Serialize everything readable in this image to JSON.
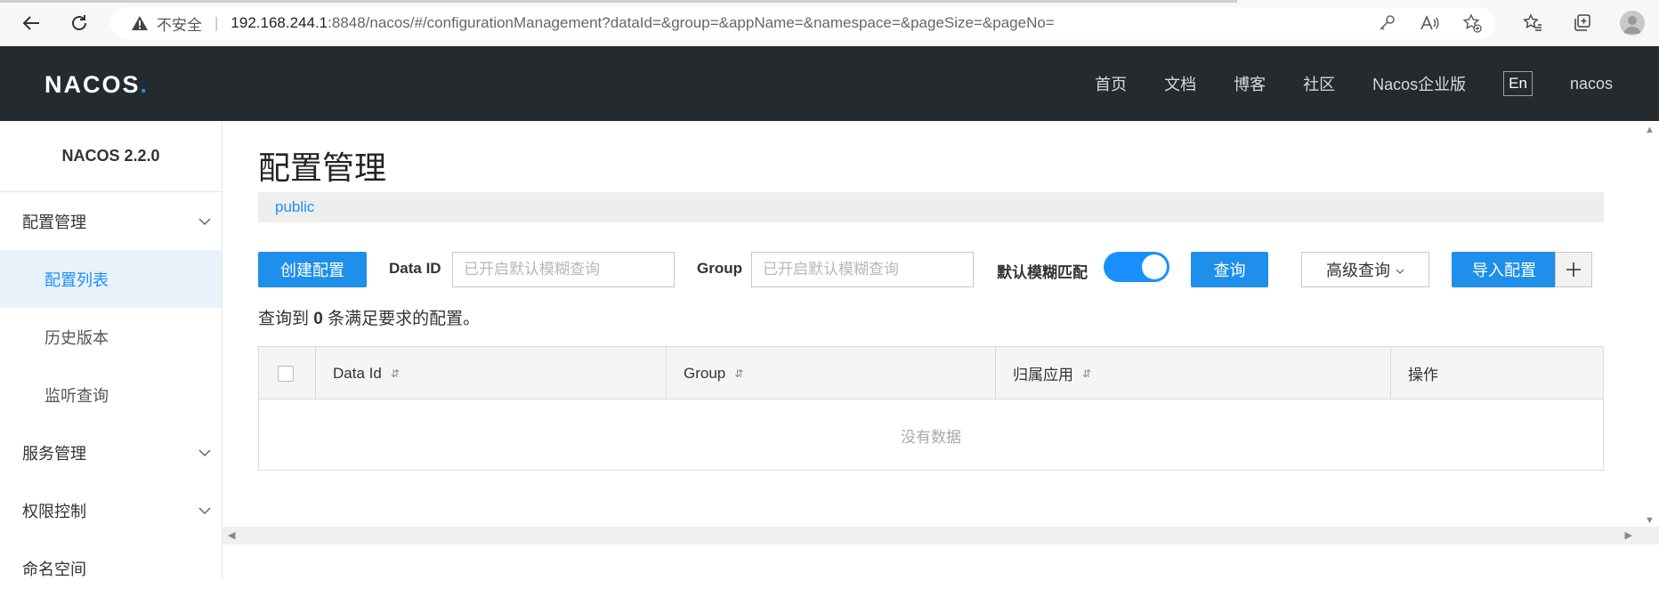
{
  "browser": {
    "insecure_label": "不安全",
    "url_host": "192.168.244.1",
    "url_path": ":8848/nacos/#/configurationManagement?dataId=&group=&appName=&namespace=&pageSize=&pageNo="
  },
  "header": {
    "logo": "NACOS",
    "logo_dot": ".",
    "menu": [
      "首页",
      "文档",
      "博客",
      "社区",
      "Nacos企业版"
    ],
    "lang": "En",
    "user": "nacos"
  },
  "sidebar": {
    "version": "NACOS 2.2.0",
    "groups": [
      {
        "label": "配置管理",
        "items": [
          "配置列表",
          "历史版本",
          "监听查询"
        ]
      },
      {
        "label": "服务管理"
      },
      {
        "label": "权限控制"
      },
      {
        "label": "命名空间"
      }
    ]
  },
  "main": {
    "title": "配置管理",
    "namespace": "public",
    "create_button": "创建配置",
    "dataid_label": "Data ID",
    "dataid_placeholder": "已开启默认模糊查询",
    "group_label": "Group",
    "group_placeholder": "已开启默认模糊查询",
    "fuzzy_label": "默认模糊匹配",
    "fuzzy_enabled": true,
    "query_button": "查询",
    "advanced_button": "高级查询",
    "import_button": "导入配置",
    "result_prefix": "查询到",
    "result_count": "0",
    "result_suffix": "条满足要求的配置。",
    "table": {
      "columns": [
        "Data Id",
        "Group",
        "归属应用",
        "操作"
      ],
      "empty": "没有数据"
    }
  }
}
